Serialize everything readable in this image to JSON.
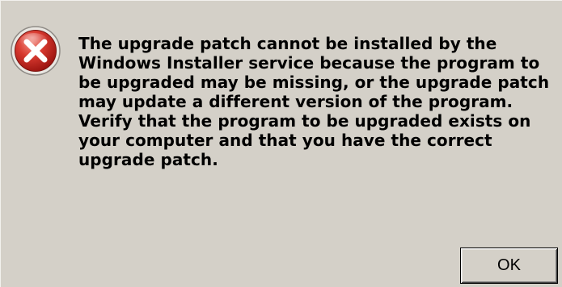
{
  "dialog": {
    "icon": "error-icon",
    "message": "The upgrade patch cannot be installed by the\nWindows Installer service because the program to\nbe upgraded may be missing, or the upgrade patch\nmay update a different version of the program.\nVerify that the program to be upgraded exists on\nyour computer and that you have the correct\nupgrade patch.",
    "ok_label": "OK"
  },
  "colors": {
    "dialog_background": "#d4d0c8",
    "error_red": "#cc1f1f"
  }
}
